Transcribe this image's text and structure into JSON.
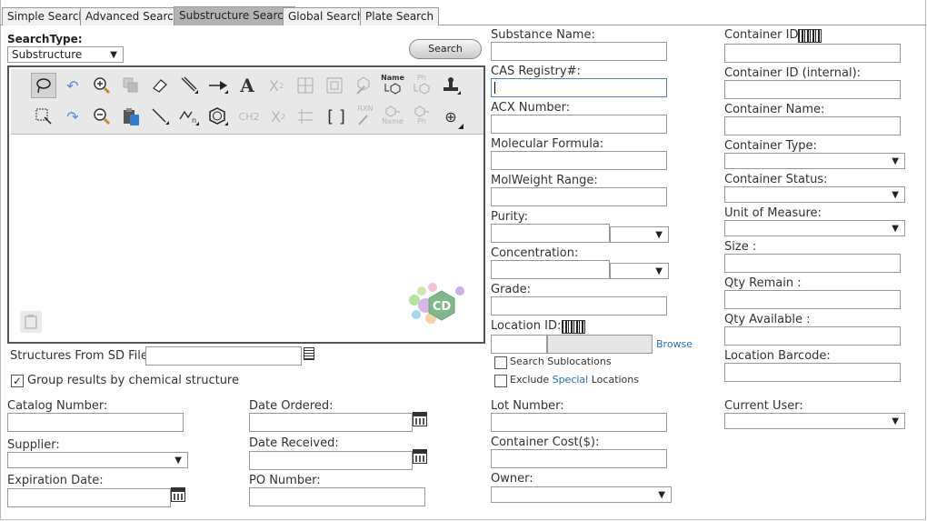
{
  "tabs": [
    "Simple Search",
    "Advanced Search",
    "Substructure Search",
    "Global Search",
    "Plate Search"
  ],
  "search_type": {
    "label": "SearchType:",
    "value": "Substructure"
  },
  "search_button": "Search",
  "toolbar_text": {
    "name": "Name",
    "ph": "Ph",
    "ch2": "CH2",
    "rxn": "RXN",
    "x2": "X",
    "brackets": "[ ]",
    "plus": "⊕"
  },
  "sd_file": {
    "label": "Structures From SD File"
  },
  "group_results": {
    "label": "Group results by chemical structure",
    "checked": "✓"
  },
  "left_bottom": {
    "catalog": "Catalog Number:",
    "supplier": "Supplier:",
    "expiration": "Expiration Date:",
    "date_ordered": "Date Ordered:",
    "date_received": "Date Received:",
    "po": "PO Number:"
  },
  "mid": {
    "substance_name": "Substance Name:",
    "cas": "CAS Registry#:",
    "acx": "ACX Number:",
    "formula": "Molecular Formula:",
    "molweight": "MolWeight Range:",
    "purity": "Purity:",
    "concentration": "Concentration:",
    "grade": "Grade:",
    "location_id": "Location ID:",
    "browse": "Browse",
    "search_sublocations": "Search Sublocations",
    "exclude": "Exclude",
    "special": "Special",
    "locations": "Locations",
    "lot": "Lot Number:",
    "cost": "Container Cost($):",
    "owner": "Owner:"
  },
  "right": {
    "container_id": "Container ID:",
    "container_id_internal": "Container ID (internal):",
    "container_name": "Container Name:",
    "container_type": "Container Type:",
    "container_status": "Container Status:",
    "unit": "Unit of Measure:",
    "size": "Size :",
    "qty_remain": "Qty Remain :",
    "qty_available": "Qty Available :",
    "location_barcode": "Location Barcode:",
    "current_user": "Current User:"
  },
  "logo_text": "CD"
}
